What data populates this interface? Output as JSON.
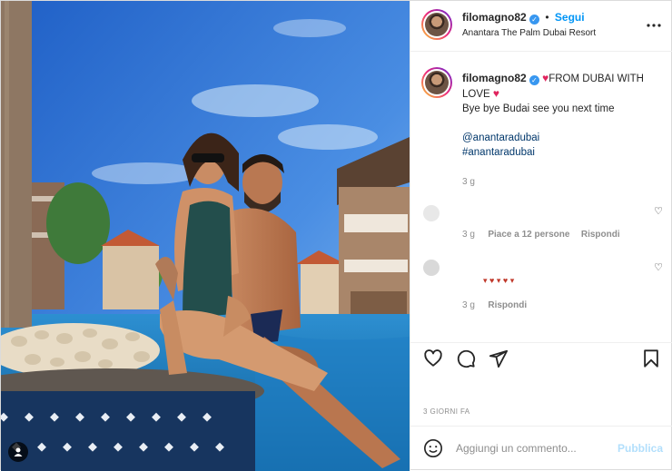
{
  "header": {
    "username": "filomagno82",
    "follow_label": "Segui",
    "location": "Anantara The Palm Dubai Resort",
    "dot": "•",
    "more": "•••"
  },
  "caption": {
    "username": "filomagno82",
    "text1": "FROM DUBAI WITH",
    "text2": "LOVE",
    "line2": "Bye bye Budai see you next time",
    "mention": "@anantaradubai",
    "hashtag": "#anantaradubai",
    "time": "3 g"
  },
  "comments": [
    {
      "time": "3 g",
      "likes": "Piace a 12 persone",
      "reply": "Rispondi"
    },
    {
      "time": "3 g",
      "reply": "Rispondi"
    }
  ],
  "date": "3 GIORNI FA",
  "composer": {
    "placeholder": "Aggiungi un commento...",
    "publish": "Pubblica"
  },
  "icons": {
    "heart": "heart-icon",
    "comment": "comment-icon",
    "share": "share-icon",
    "save": "bookmark-icon",
    "emoji": "emoji-icon",
    "more": "more-icon",
    "verified": "verified-icon",
    "user": "user-tag-icon"
  },
  "colors": {
    "accent": "#0095f6",
    "verified": "#3897f0",
    "heart": "#e0245e",
    "publish_disabled": "#b2dffc"
  }
}
